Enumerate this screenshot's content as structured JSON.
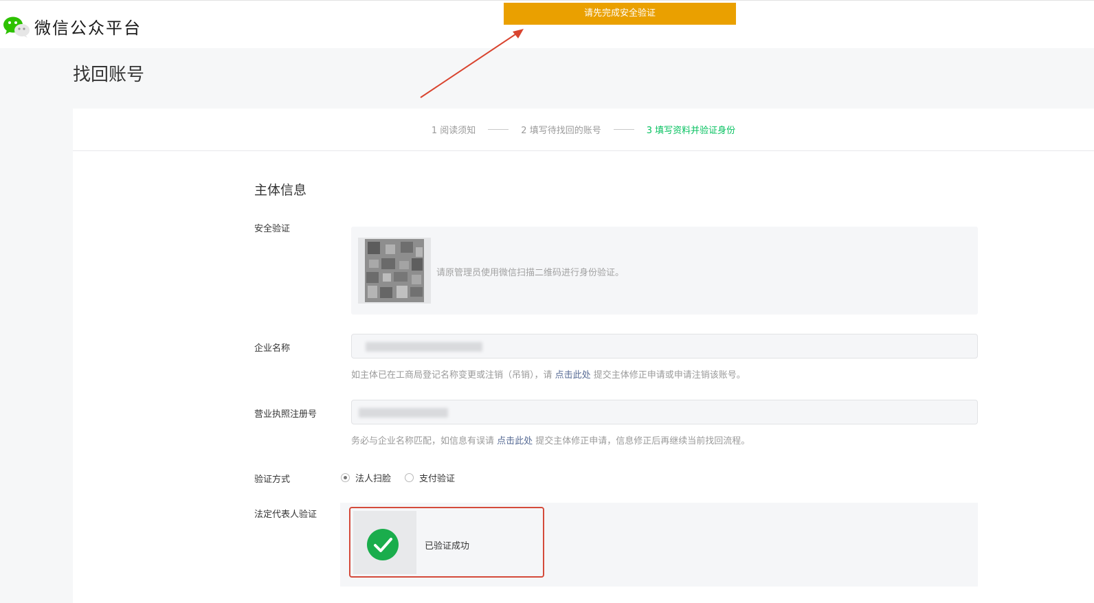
{
  "header": {
    "logo_text": "微信公众平台",
    "logo_icon": "wechat-logo-icon"
  },
  "toast": {
    "message": "请先完成安全验证",
    "color": "#eaa000"
  },
  "page": {
    "title": "找回账号"
  },
  "steps": [
    {
      "label": "1 阅读须知",
      "active": false
    },
    {
      "label": "2 填写待找回的账号",
      "active": false
    },
    {
      "label": "3 填写资料并验证身份",
      "active": true
    }
  ],
  "form": {
    "section_title": "主体信息",
    "security": {
      "label": "安全验证",
      "hint": "请原管理员使用微信扫描二维码进行身份验证。"
    },
    "company_name": {
      "label": "企业名称",
      "hint_before": "如主体已在工商局登记名称变更或注销（吊销），请 ",
      "hint_link": "点击此处",
      "hint_after": " 提交主体修正申请或申请注销该账号。"
    },
    "license_no": {
      "label": "营业执照注册号",
      "hint_before": "务必与企业名称匹配，如信息有误请 ",
      "hint_link": "点击此处",
      "hint_after": " 提交主体修正申请，信息修正后再继续当前找回流程。"
    },
    "verify_method": {
      "label": "验证方式",
      "options": [
        {
          "label": "法人扫脸",
          "selected": true
        },
        {
          "label": "支付验证",
          "selected": false
        }
      ]
    },
    "legal_rep": {
      "label": "法定代表人验证",
      "status": "已验证成功"
    }
  },
  "colors": {
    "accent_green": "#07c160",
    "link_blue": "#576b95",
    "highlight_red": "#d44a3a"
  }
}
